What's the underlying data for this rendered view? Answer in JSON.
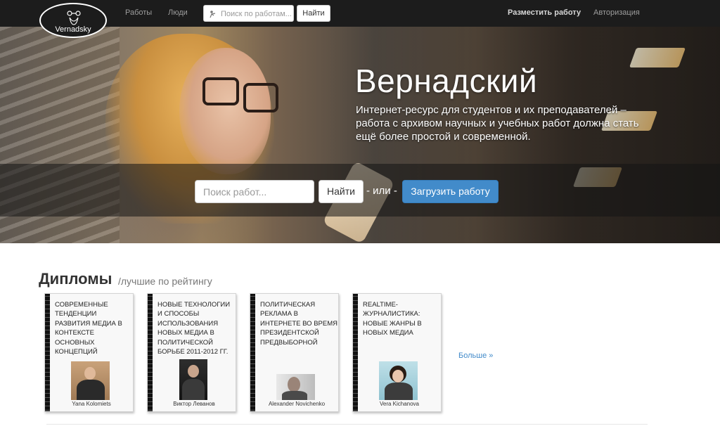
{
  "nav": {
    "logo_text": "Vernadsky",
    "links": [
      "Работы",
      "Люди"
    ],
    "search_placeholder": "Поиск по работам...",
    "search_button": "Найти",
    "post_work": "Разместить работу",
    "login": "Авторизация"
  },
  "hero": {
    "title": "Вернадский",
    "subtitle": "Интернет-ресурс для студентов и их преподавателей – работа с архивом научных и учебных работ должна стать ещё более простой и современной.",
    "search_placeholder": "Поиск работ...",
    "search_button": "Найти",
    "or_text": "- или -",
    "upload_button": "Загрузить работу"
  },
  "section": {
    "title": "Дипломы",
    "subtitle": "/лучшие по рейтингу",
    "more_link": "Больше »",
    "works": [
      {
        "title": "Современные тенденции развития медиа в контексте основных концепций",
        "author": "Yana Kolomiets"
      },
      {
        "title": "Новые технологии и способы использования новых медиа в политической борьбе 2011-2012 гг.",
        "author": "Виктор Леванов"
      },
      {
        "title": "Политическая реклама в интернете во время президентской предвыборной",
        "author": "Alexander Novichenko"
      },
      {
        "title": "Realtime-журналистика: новые жанры в новых медиа",
        "author": "Vera Kichanova"
      }
    ]
  },
  "colors": {
    "navbar": "#1c1c1c",
    "primary": "#428bca",
    "link": "#428bca"
  }
}
